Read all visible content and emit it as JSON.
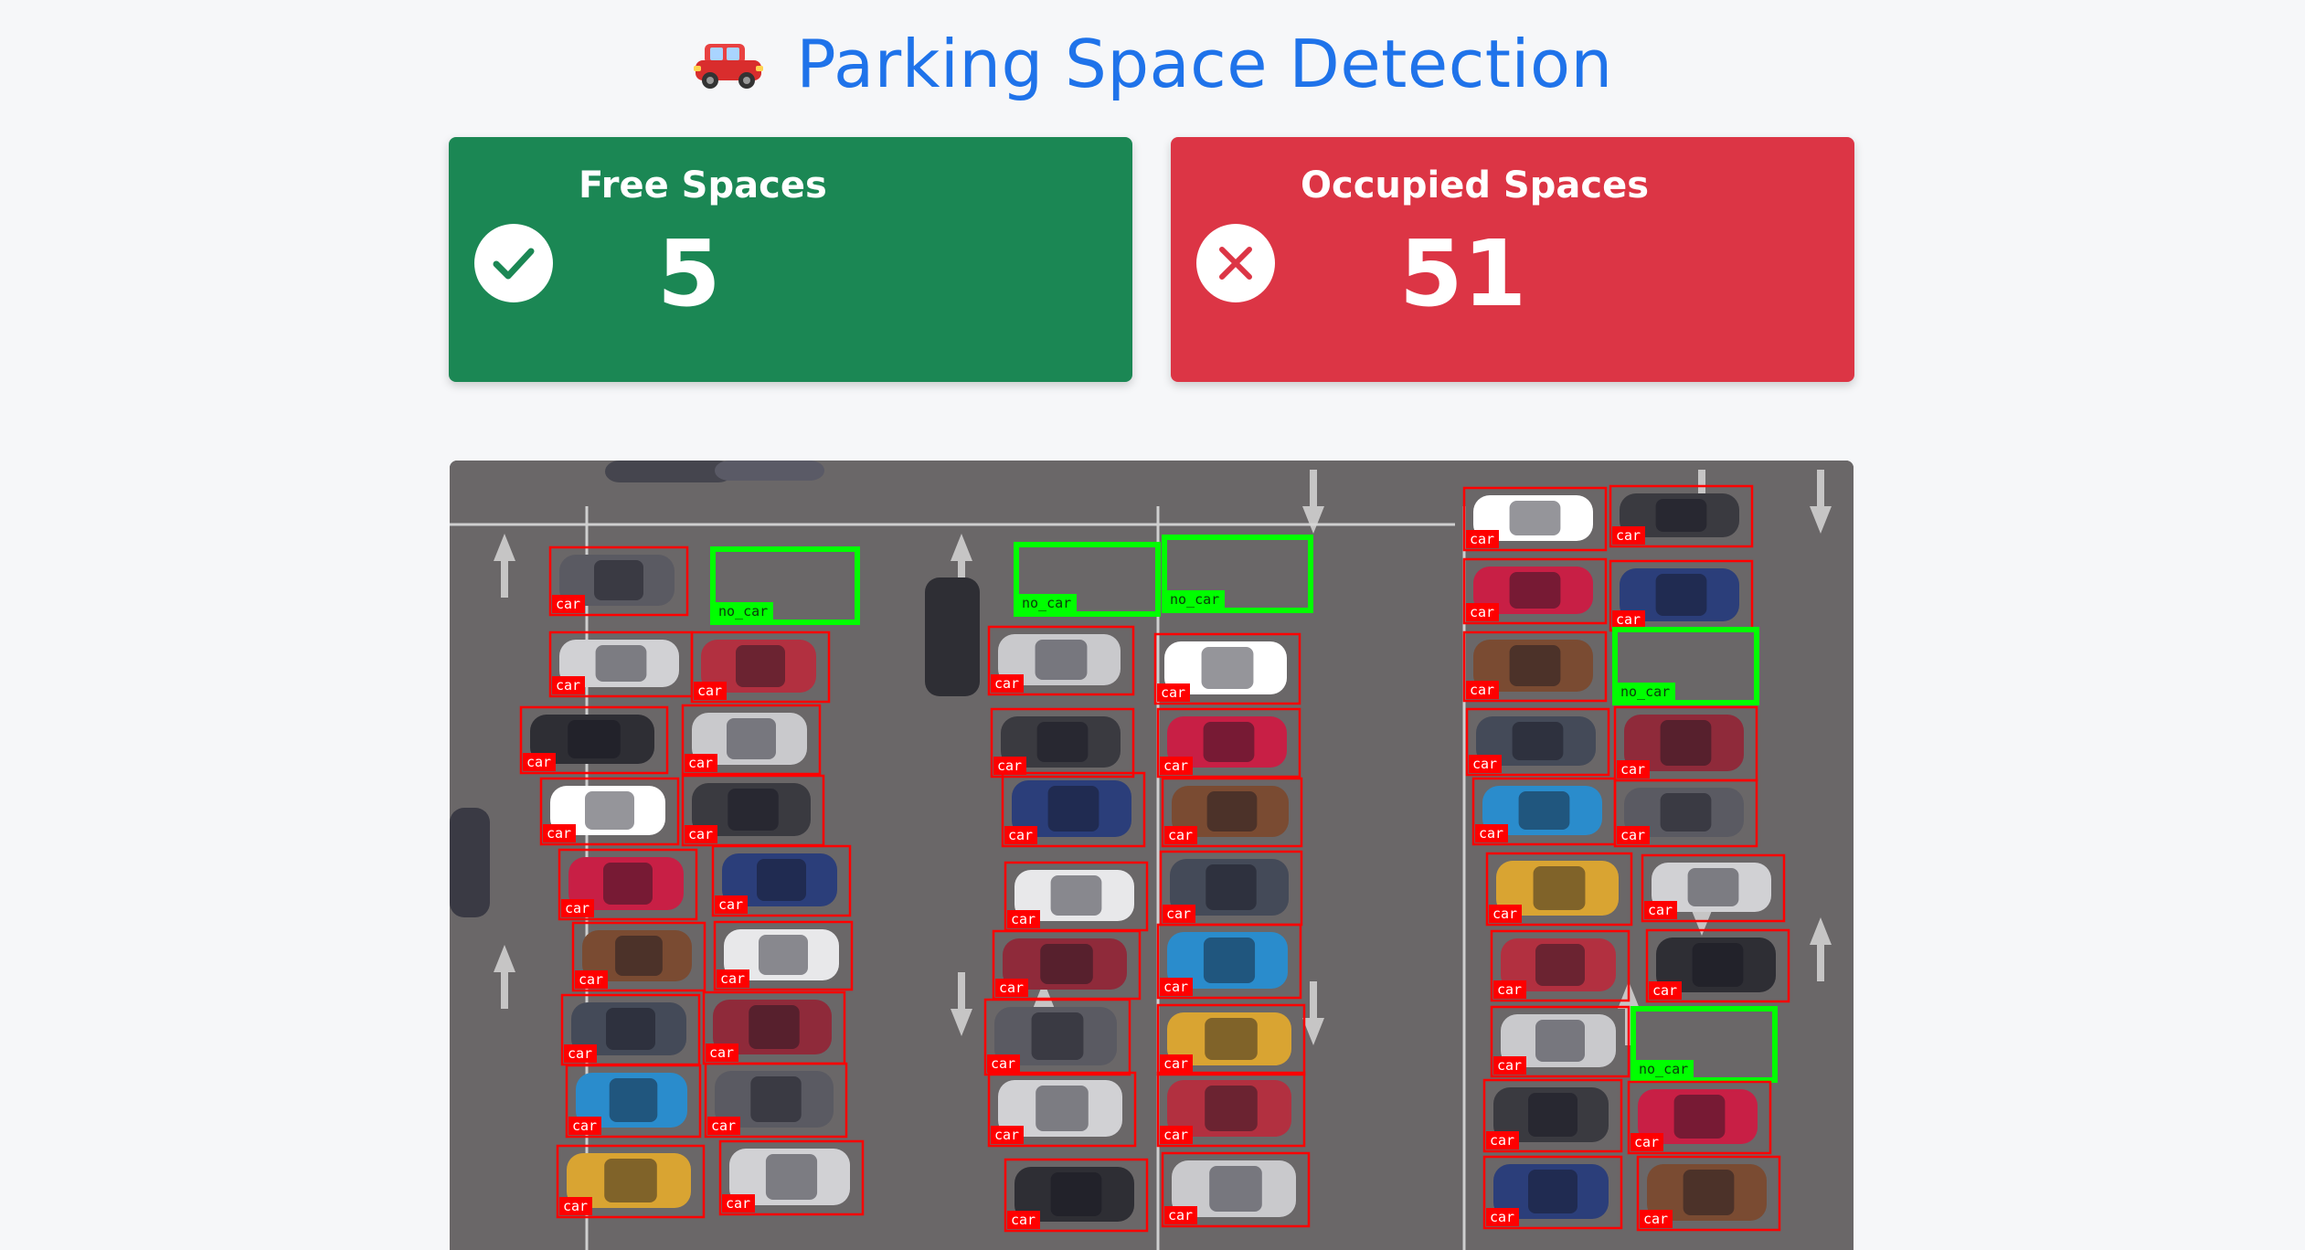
{
  "header": {
    "title": "Parking Space Detection",
    "icon": "car-icon"
  },
  "stats": {
    "free": {
      "label": "Free Spaces",
      "value": "5",
      "icon": "check-icon",
      "color": "#1b8754"
    },
    "occupied": {
      "label": "Occupied Spaces",
      "value": "51",
      "icon": "x-icon",
      "color": "#dc3545"
    }
  },
  "detection": {
    "occupied_label": "car",
    "free_label": "no_car",
    "occupied_color": "#ff0000",
    "free_color": "#00ff00"
  }
}
